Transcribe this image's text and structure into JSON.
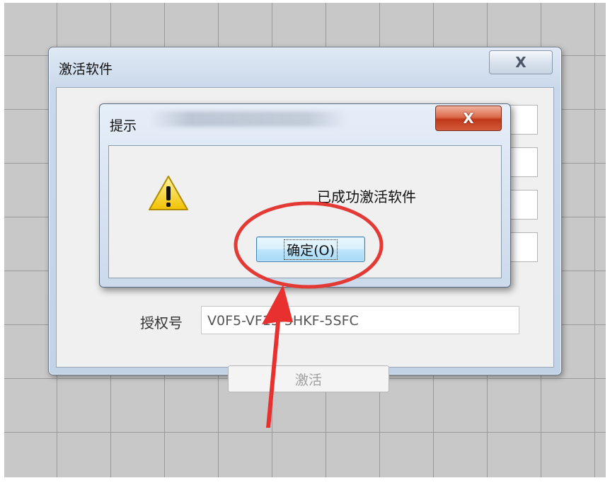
{
  "outer_dialog": {
    "title": "激活软件",
    "close_glyph": "X",
    "auth_label": "授权号",
    "auth_value": "V0F5-VF15-5HKF-5SFC",
    "activate_button": "激活"
  },
  "message_box": {
    "title": "提示",
    "close_glyph": "X",
    "message": "已成功激活软件",
    "ok_button": "确定(O)",
    "icon": "warning-icon"
  },
  "annotation": {
    "circle_color": "#e43a35",
    "arrow_color": "#e8302f"
  },
  "colors": {
    "grid_background": "#c8c8c8",
    "close_button_red": "#c0391a",
    "focus_button_blue": "#3c7fb1"
  }
}
